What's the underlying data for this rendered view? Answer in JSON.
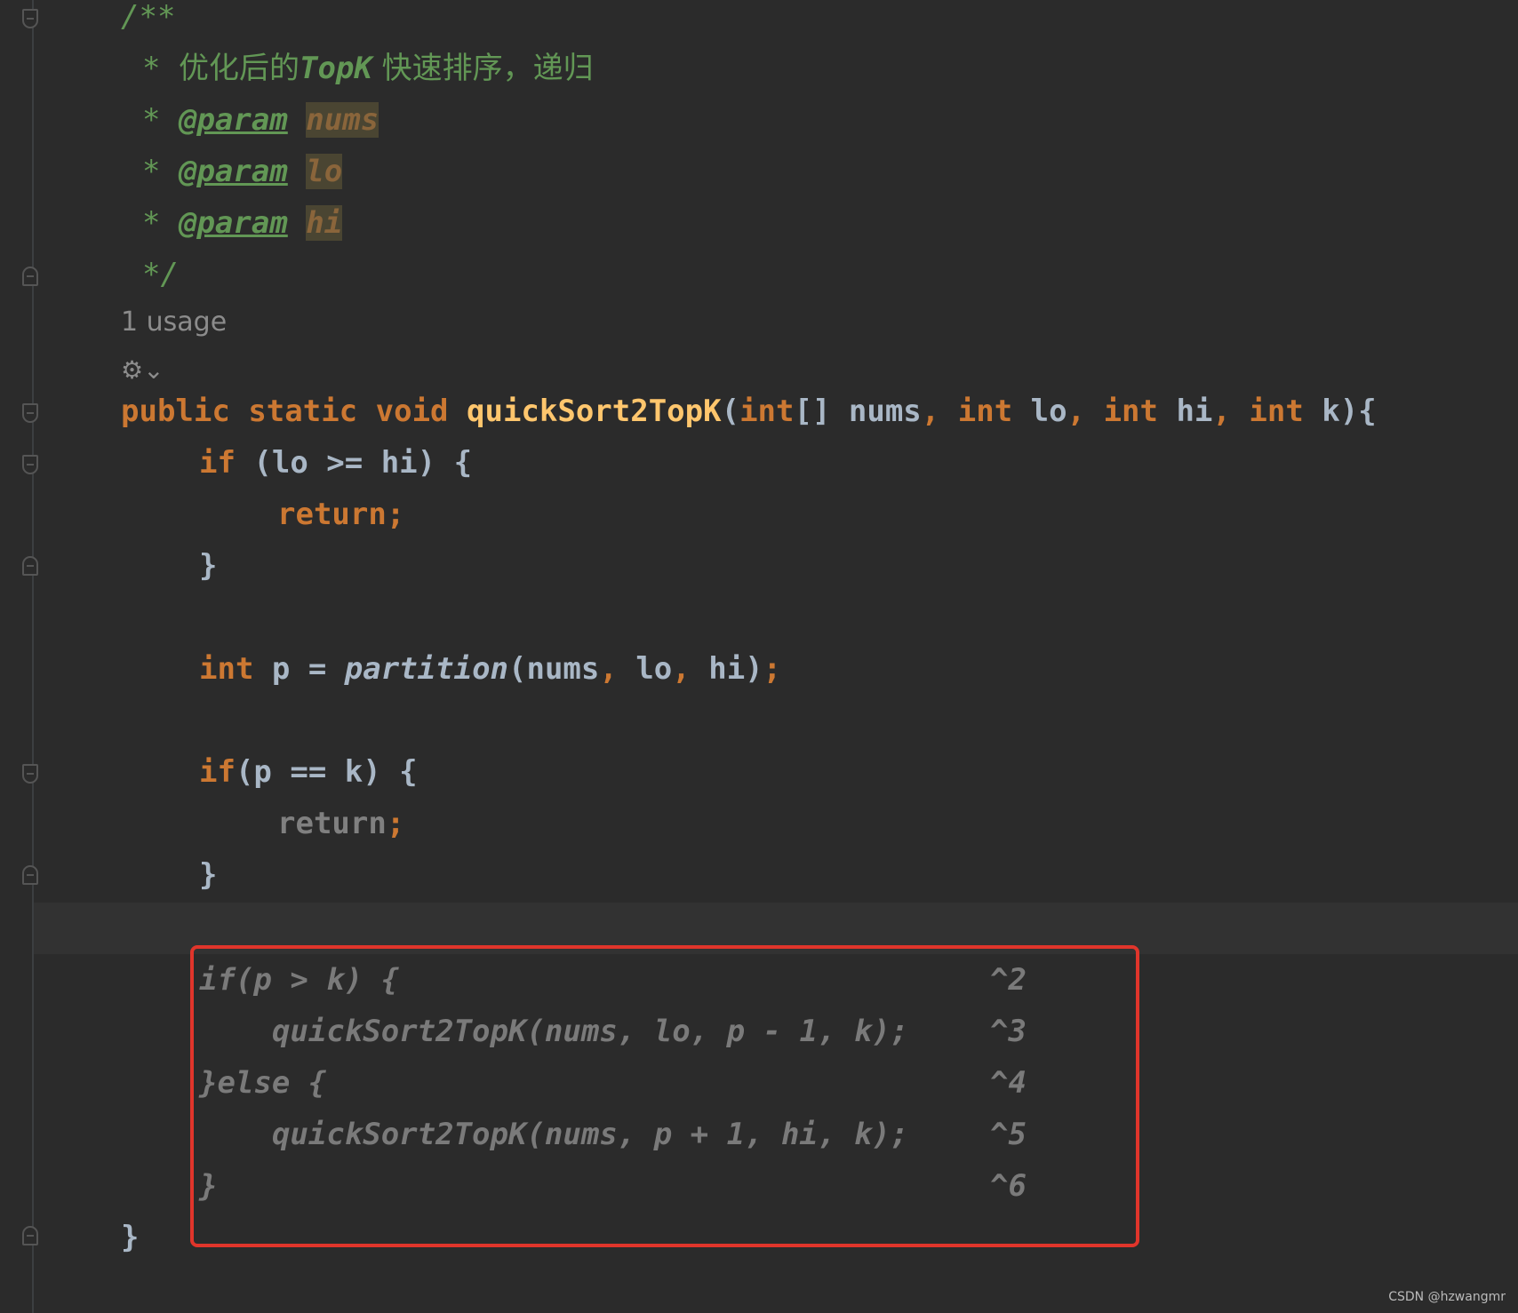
{
  "gutter_markers": [
    "fold-open",
    "fold-close",
    "fold-open",
    "fold-open",
    "fold-close",
    "fold-open",
    "fold-close",
    "fold-close"
  ],
  "doc": {
    "open": "/**",
    "star": "*",
    "desc_cn1": "优化后的",
    "desc_topk": "TopK",
    "desc_cn2": " 快速排序，递归",
    "tag": "@param",
    "params": [
      "nums",
      "lo",
      "hi"
    ],
    "close": "*/"
  },
  "usage_hint": "1 usage",
  "ai_icon_label": "⚙︎⌄",
  "code": {
    "sig_public": "public",
    "sig_static": "static",
    "sig_void": "void",
    "method_name": "quickSort2TopK",
    "sig_args_1": "(",
    "sig_int_arr": "int",
    "sig_args_2": "[] nums",
    "comma": ",",
    "sig_int": "int",
    "sig_lo": " lo",
    "sig_hi": " hi",
    "sig_k": " k){",
    "if": "if",
    "cond1": " (lo >= hi) {",
    "return": "return",
    "semi": ";",
    "rbrace": "}",
    "int": "int",
    "assign": " p = ",
    "partition": "partition",
    "part_args_1": "(nums",
    "part_args_2": " lo",
    "part_args_3": " hi)",
    "cond2": "(p == k) {"
  },
  "suggestion": {
    "lines": [
      "if(p > k) {",
      "    quickSort2TopK(nums, lo, p - 1, k);",
      "}else {",
      "    quickSort2TopK(nums, p + 1, hi, k);",
      "}"
    ],
    "shortcuts": [
      "^2",
      "^3",
      "^4",
      "^5",
      "^6"
    ]
  },
  "closing_brace": "}",
  "watermark": "CSDN @hzwangmr",
  "colors": {
    "background": "#2b2b2b",
    "keyword": "#cc7832",
    "method": "#ffc66d",
    "comment": "#629755",
    "identifier": "#a9b7c6",
    "highlight_box": "#e0352b"
  }
}
